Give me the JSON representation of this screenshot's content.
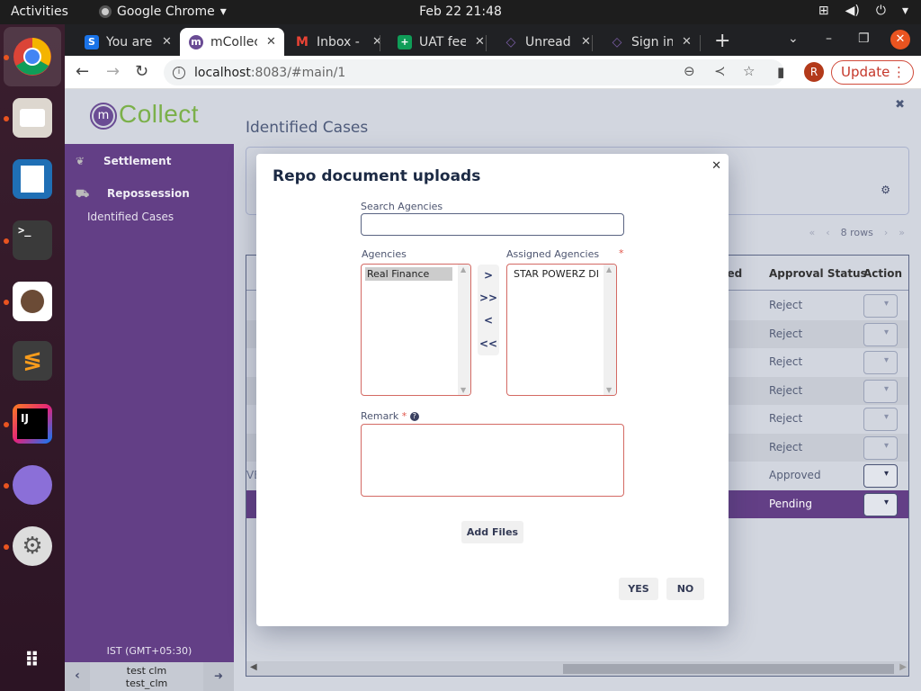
{
  "os": {
    "activities": "Activities",
    "app_name": "Google Chrome",
    "clock": "Feb 22  21:48",
    "tray_icons": [
      "network-icon",
      "volume-icon",
      "power-icon",
      "chevron-down-icon"
    ]
  },
  "dock": {
    "items": [
      {
        "name": "chrome",
        "running": true
      },
      {
        "name": "files",
        "running": true
      },
      {
        "name": "libreoffice-writer",
        "running": false
      },
      {
        "name": "terminal",
        "running": true
      },
      {
        "name": "dbeaver",
        "running": true
      },
      {
        "name": "sublime-text",
        "running": false
      },
      {
        "name": "intellij-idea",
        "running": true
      },
      {
        "name": "network-browser",
        "running": true
      },
      {
        "name": "settings",
        "running": true
      }
    ],
    "apps_grid": "show-applications"
  },
  "browser": {
    "tabs": [
      {
        "title": "You are",
        "favicon": "S",
        "favicon_color": "#1a73e8",
        "active": false
      },
      {
        "title": "mCollec",
        "favicon": "m",
        "favicon_color": "#6a4c94",
        "active": true
      },
      {
        "title": "Inbox - r",
        "favicon": "M",
        "favicon_color": "#ea4335",
        "active": false
      },
      {
        "title": "UAT fee",
        "favicon": "+",
        "favicon_color": "#0f9d58",
        "active": false
      },
      {
        "title": "Unread",
        "favicon": "◇",
        "favicon_color": "#7b5ea7",
        "active": false
      },
      {
        "title": "Sign in",
        "favicon": "◇",
        "favicon_color": "#7b5ea7",
        "active": false
      }
    ],
    "url_host": "localhost",
    "url_path": ":8083/#main/1",
    "profile_initial": "R",
    "update_label": "Update"
  },
  "app": {
    "logo_text": "Collect",
    "logo_mark": "m",
    "menu": [
      {
        "label": "Settlement",
        "icon": "settlement-icon"
      },
      {
        "label": "Repossession",
        "icon": "tow-truck-icon"
      }
    ],
    "submenu": [
      {
        "label": "Identified Cases"
      }
    ],
    "timezone": "IST (GMT+05:30)",
    "user_display": "test clm",
    "user_login": "test_clm",
    "page_title": "Identified Cases",
    "pager": {
      "label": "8 rows"
    },
    "grid": {
      "columns": [
        "ued",
        "Approval Status",
        "Action"
      ],
      "rows": [
        {
          "status": "Reject",
          "fragment": ""
        },
        {
          "status": "Reject",
          "fragment": ""
        },
        {
          "status": "Reject",
          "fragment": ""
        },
        {
          "status": "Reject",
          "fragment": ""
        },
        {
          "status": "Reject",
          "fragment": ""
        },
        {
          "status": "Reject",
          "fragment": ""
        },
        {
          "status": "Approved",
          "fragment": "VE"
        },
        {
          "status": "Pending",
          "fragment": ""
        }
      ],
      "selected_row": 7
    }
  },
  "modal": {
    "title": "Repo document uploads",
    "search_label": "Search Agencies",
    "search_value": "",
    "search_placeholder": "",
    "agencies_label": "Agencies",
    "agencies": [
      "Real Finance"
    ],
    "assigned_label": "Assigned Agencies",
    "assigned": [
      "STAR POWERZ DIGITA"
    ],
    "required_mark": "*",
    "move_buttons": [
      ">",
      ">>",
      "<",
      "<<"
    ],
    "remark_label": "Remark",
    "remark_value": "",
    "add_files_label": "Add Files",
    "yes_label": "YES",
    "no_label": "NO"
  }
}
